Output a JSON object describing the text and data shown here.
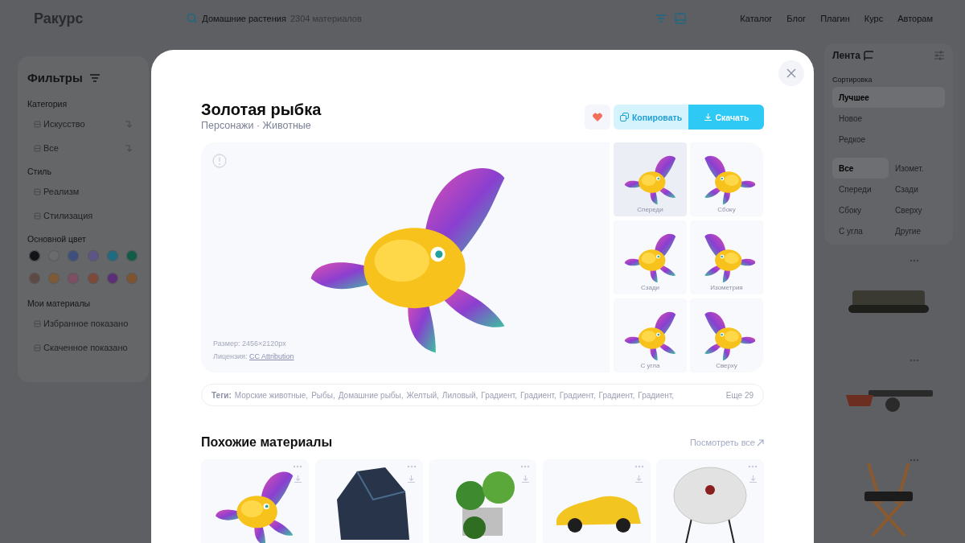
{
  "app": {
    "logo": "Ракурс"
  },
  "search": {
    "query": "Домашние растения",
    "count": "2304 материалов"
  },
  "nav": [
    "Каталог",
    "Блог",
    "Плагин",
    "Курс",
    "Авторам"
  ],
  "filters": {
    "title": "Фильтры",
    "sections": [
      {
        "heading": "Категория",
        "kind": "list",
        "items": [
          {
            "label": "Искусство",
            "dropdown": true
          },
          {
            "label": "Все",
            "dropdown": true
          }
        ]
      },
      {
        "heading": "Стиль",
        "kind": "list",
        "items": [
          {
            "label": "Реализм",
            "dropdown": false
          },
          {
            "label": "Стилизация",
            "dropdown": false
          }
        ]
      },
      {
        "heading": "Основной цвет",
        "kind": "colors",
        "colors": [
          {
            "kind": "solid",
            "color": "#121316"
          },
          {
            "kind": "solid",
            "color": "#6a6b6d"
          },
          {
            "kind": "solid",
            "color": "#3e4f7e"
          },
          {
            "kind": "solid",
            "color": "#5e5587"
          },
          {
            "kind": "solid",
            "color": "#1f6c80"
          },
          {
            "kind": "solid",
            "color": "#125c47"
          },
          {
            "kind": "solid",
            "color": "#5d4a44"
          },
          {
            "kind": "solid",
            "color": "#7e5a36"
          },
          {
            "kind": "solid",
            "color": "#7e4e63"
          },
          {
            "kind": "solid",
            "color": "#7d4a3a"
          },
          {
            "kind": "gradient",
            "color": "#5a2f78"
          },
          {
            "kind": "solid",
            "color": "#7e5330"
          }
        ]
      },
      {
        "heading": "Мои материалы",
        "kind": "list",
        "items": [
          {
            "label": "Избранное показано",
            "dropdown": false
          },
          {
            "label": "Скаченное показано",
            "dropdown": false
          }
        ]
      }
    ]
  },
  "feed": {
    "title": "Лента",
    "sort_heading": "Сортировка",
    "sort": [
      {
        "label": "Лучшее",
        "selected": true
      },
      {
        "label": "Новое",
        "selected": false
      },
      {
        "label": "Редкое",
        "selected": false
      }
    ],
    "views": [
      {
        "label": "Все",
        "selected": true
      },
      {
        "label": "Изомет.",
        "selected": false
      },
      {
        "label": "Спереди",
        "selected": false
      },
      {
        "label": "Сзади",
        "selected": false
      },
      {
        "label": "Сбоку",
        "selected": false
      },
      {
        "label": "Сверху",
        "selected": false
      },
      {
        "label": "С угла",
        "selected": false
      },
      {
        "label": "Другие",
        "selected": false
      }
    ],
    "items": [
      {
        "kind": "tank"
      },
      {
        "kind": "gun"
      },
      {
        "kind": "chair"
      }
    ]
  },
  "modal": {
    "title": "Золотая рыбка",
    "subtitle": "Персонажи · Животные",
    "favorite": true,
    "copy_button": "Копировать",
    "download_button": "Скачать",
    "size": "Размер: 2456×2120px",
    "license_label": "Лицензия:",
    "license_link": "CC Attribution",
    "views": [
      {
        "label": "Спереди",
        "selected": true
      },
      {
        "label": "Сбоку",
        "selected": false
      },
      {
        "label": "Сзади",
        "selected": false
      },
      {
        "label": "Изометрия",
        "selected": false
      },
      {
        "label": "С угла",
        "selected": false
      },
      {
        "label": "Сверху",
        "selected": false
      }
    ],
    "tags_label": "Теги:",
    "tags": [
      "Морские животные,",
      "Рыбы,",
      "Домашние рыбы,",
      "Желтый,",
      "Лиловый,",
      "Градиент,",
      "Градиент,",
      "Градиент,",
      "Градиент,",
      "Градиент,"
    ],
    "more_tags": "Еще 29",
    "similar_title": "Похожие материалы",
    "see_all": "Посмотреть все",
    "similar": [
      {
        "kind": "fish"
      },
      {
        "kind": "rock"
      },
      {
        "kind": "plants"
      },
      {
        "kind": "car"
      },
      {
        "kind": "table"
      }
    ]
  }
}
